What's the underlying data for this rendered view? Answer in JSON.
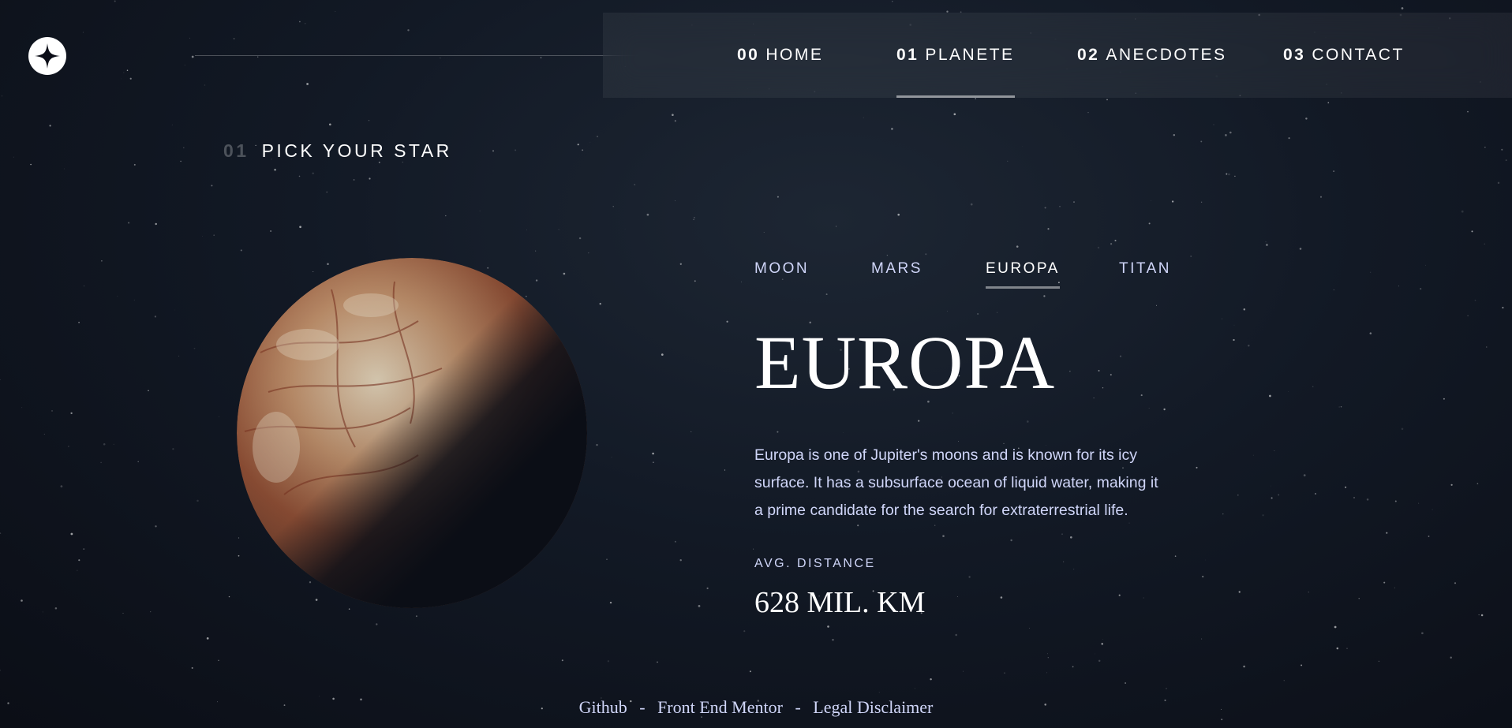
{
  "header": {
    "logo_icon": "star-logo-icon",
    "nav": [
      {
        "num": "00",
        "label": "HOME"
      },
      {
        "num": "01",
        "label": "PLANETE"
      },
      {
        "num": "02",
        "label": "ANECDOTES"
      },
      {
        "num": "03",
        "label": "CONTACT"
      }
    ],
    "active_nav": "PLANETE"
  },
  "main": {
    "section": {
      "num": "01",
      "title": "PICK YOUR STAR"
    },
    "tabs": [
      "MOON",
      "MARS",
      "EUROPA",
      "TITAN"
    ],
    "active_tab": "EUROPA",
    "planet": {
      "name": "EUROPA",
      "description": "Europa is one of Jupiter's moons and is known for its icy surface. It has a subsurface ocean of liquid water, making it a prime candidate for the search for extraterrestrial life.",
      "stat_label": "AVG. DISTANCE",
      "stat_value": "628 MIL. KM"
    }
  },
  "footer": {
    "links": [
      "Github",
      "Front End Mentor",
      "Legal Disclaimer"
    ],
    "separator": "-"
  },
  "colors": {
    "background": "#0b0e16",
    "text_light": "#d0d6f9",
    "accent": "#ffffff"
  }
}
